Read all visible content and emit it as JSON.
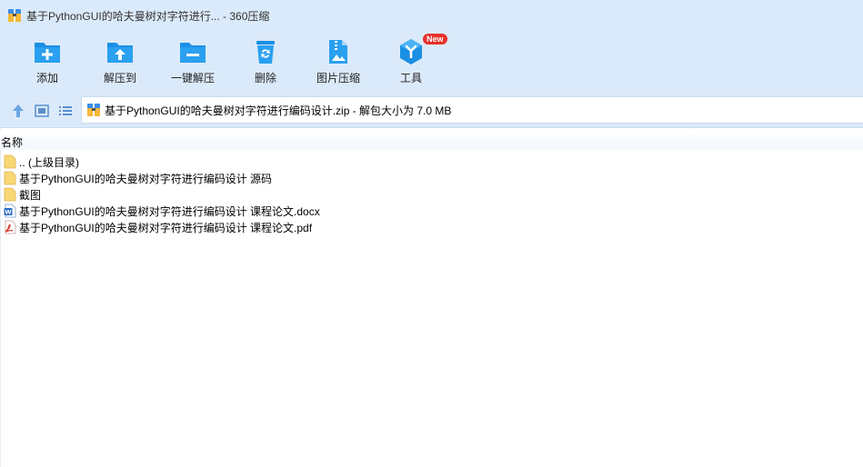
{
  "window": {
    "title": "基于PythonGUI的哈夫曼树对字符进行... - 360压缩",
    "title_icon": "archive-icon"
  },
  "toolbar": {
    "items": [
      {
        "label": "添加",
        "icon": "folder-add-icon"
      },
      {
        "label": "解压到",
        "icon": "folder-extract-icon"
      },
      {
        "label": "一键解压",
        "icon": "folder-oneclick-icon"
      },
      {
        "label": "删除",
        "icon": "recycle-bin-icon"
      },
      {
        "label": "图片压缩",
        "icon": "image-compress-icon"
      },
      {
        "label": "工具",
        "icon": "tools-icon",
        "badge": "New"
      }
    ]
  },
  "addressbar": {
    "nav": [
      "up-arrow-icon",
      "view-thumb-icon",
      "view-list-icon"
    ],
    "path": "基于PythonGUI的哈夫曼树对字符进行编码设计.zip - 解包大小为 7.0 MB"
  },
  "filelist": {
    "column_name": "名称",
    "rows": [
      {
        "name": ".. (上级目录)",
        "icon": "folder-icon"
      },
      {
        "name": "基于PythonGUI的哈夫曼树对字符进行编码设计 源码",
        "icon": "folder-icon"
      },
      {
        "name": "截图",
        "icon": "folder-icon"
      },
      {
        "name": "基于PythonGUI的哈夫曼树对字符进行编码设计 课程论文.docx",
        "icon": "word-doc-icon"
      },
      {
        "name": "基于PythonGUI的哈夫曼树对字符进行编码设计 课程论文.pdf",
        "icon": "pdf-icon"
      }
    ]
  },
  "colors": {
    "chrome_bg": "#dbeafa",
    "icon_blue": "#1a8fe3",
    "badge_red": "#e8312b",
    "folder_yellow": "#f8d775"
  }
}
